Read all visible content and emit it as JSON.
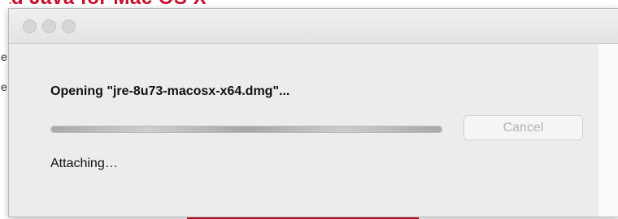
{
  "background": {
    "headline_fragment": "ad Java for Mac OS X",
    "left_glyphs": [
      "e",
      "e"
    ],
    "accent_color": "#c8102e"
  },
  "window": {
    "title": "",
    "traffic_lights": [
      "close-button",
      "minimize-button",
      "zoom-button"
    ]
  },
  "dialog": {
    "opening_text": "Opening \"jre-8u73-macosx-x64.dmg\"...",
    "progress_fraction": 1.0,
    "progress_indeterminate": true,
    "cancel_label": "Cancel",
    "cancel_enabled": false,
    "status_text": "Attaching…"
  }
}
